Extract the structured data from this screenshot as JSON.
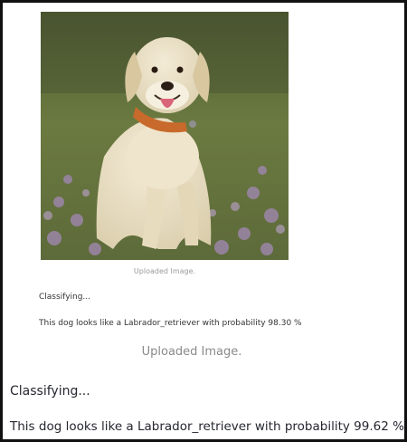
{
  "screens": [
    {
      "image_caption": "Uploaded Image.",
      "status_text": "Classifying...",
      "result_text": "This dog looks like a Labrador_retriever with probability 98.30 %"
    },
    {
      "image_caption": "Uploaded Image.",
      "status_text": "Classifying...",
      "result_text": "This dog looks like a Labrador_retriever with probability 99.62 %"
    }
  ],
  "colors": {
    "border": "#111111",
    "caption": "#9a9a9a",
    "text": "#262730"
  }
}
